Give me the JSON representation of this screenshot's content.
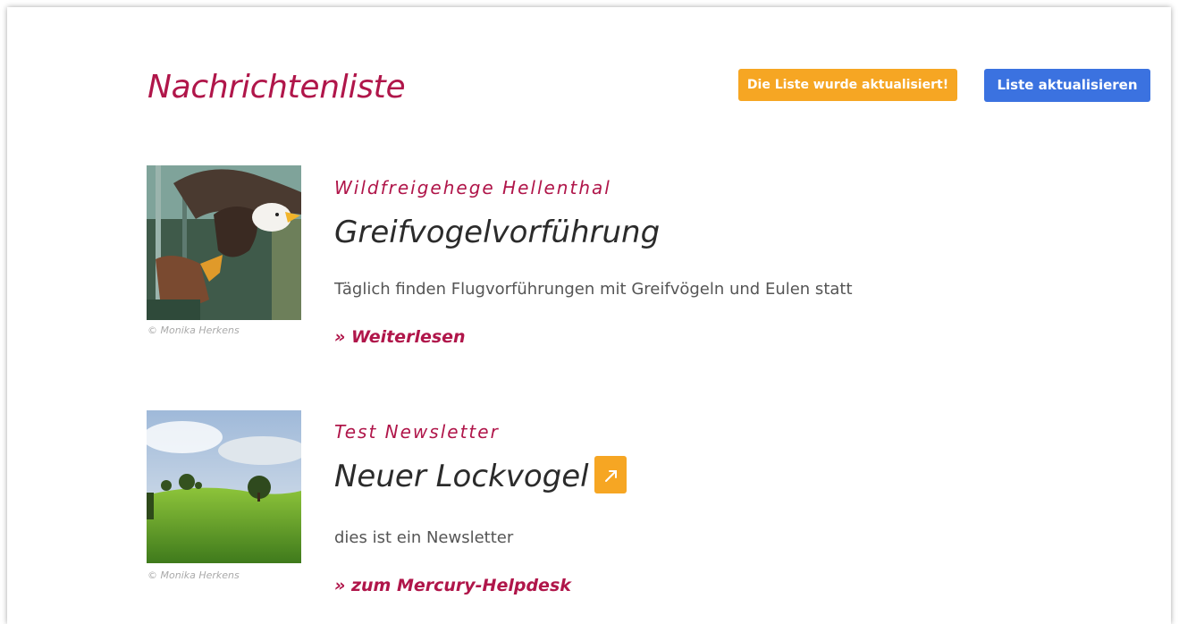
{
  "header": {
    "title": "Nachrichtenliste",
    "status_badge": "Die Liste wurde aktualisiert!",
    "refresh_button": "Liste aktualisieren"
  },
  "items": [
    {
      "image_icon": "eagle-photo",
      "credit": "© Monika Herkens",
      "source": "Wildfreigehege Hellenthal",
      "title": "Greifvogelvorführung",
      "summary": "Täglich finden Flugvorführungen mit Greifvögeln und Eulen statt",
      "link": "» Weiterlesen",
      "external_icon": null
    },
    {
      "image_icon": "meadow-photo",
      "credit": "© Monika Herkens",
      "source": "Test Newsletter",
      "title": "Neuer Lockvogel",
      "summary": "dies ist ein Newsletter",
      "link": "» zum Mercury-Helpdesk",
      "external_icon": "external-link-icon"
    }
  ],
  "colors": {
    "accent": "#b0164a",
    "badge": "#f6a623",
    "button": "#3b72e0"
  }
}
